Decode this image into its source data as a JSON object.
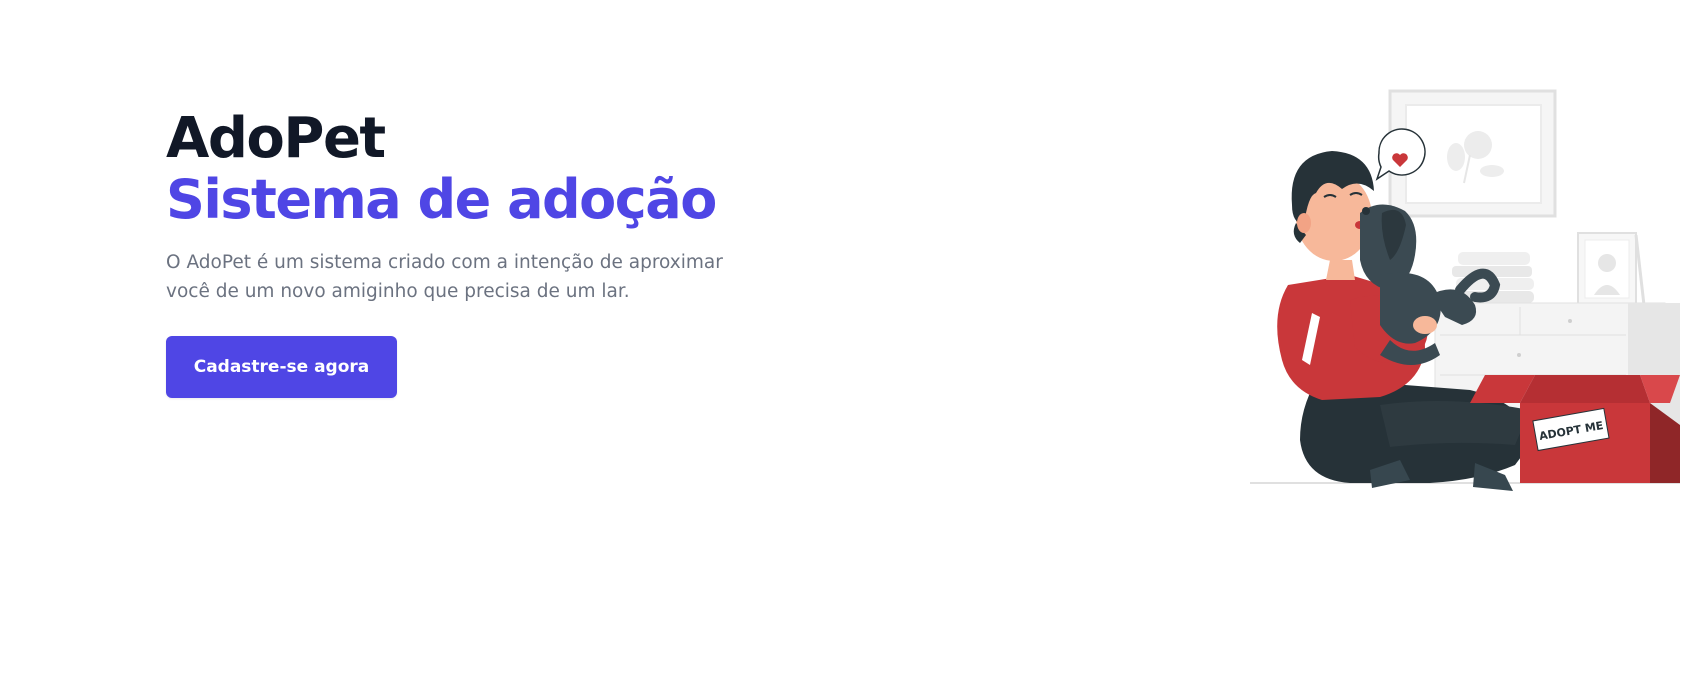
{
  "hero": {
    "title": "AdoPet",
    "subtitle": "Sistema de adoção",
    "description": "O AdoPet é um sistema criado com a intenção de aproximar você de um novo amiginho que precisa de um lar.",
    "cta_label": "Cadastre-se agora"
  },
  "illustration": {
    "box_label": "ADOPT ME",
    "icons": [
      "heart-icon",
      "speech-bubble-icon",
      "picture-frame-icon",
      "adoption-box-icon"
    ]
  },
  "colors": {
    "brand_dark": "#111827",
    "accent": "#4f46e5",
    "muted_text": "#6b7280",
    "sweater_red": "#c9373a",
    "dark_gray": "#263238"
  }
}
